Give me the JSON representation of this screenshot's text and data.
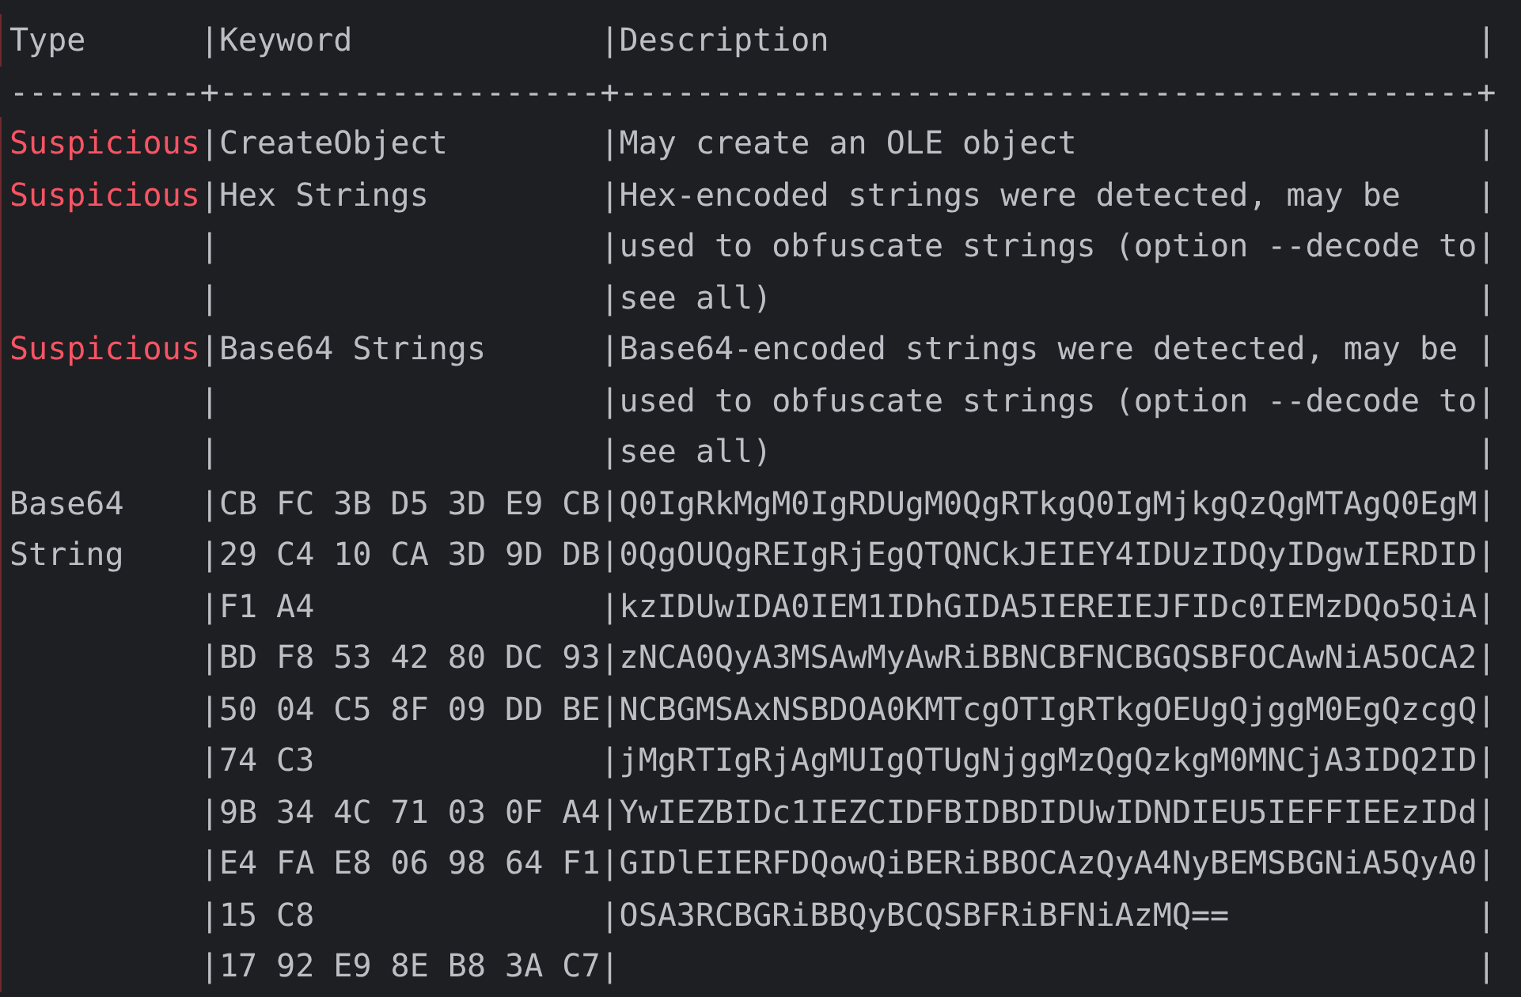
{
  "table": {
    "separator": "|",
    "columns": [
      "Type",
      "Keyword",
      "Description"
    ],
    "rule": "----------+--------------------+---------------------------------------------+",
    "rows": [
      {
        "kind": "suspicious",
        "type": [
          "Suspicious"
        ],
        "keyword": [
          "CreateObject"
        ],
        "description": [
          "May create an OLE object"
        ]
      },
      {
        "kind": "suspicious",
        "type": [
          "Suspicious"
        ],
        "keyword": [
          "Hex Strings"
        ],
        "description": [
          "Hex-encoded strings were detected, may be",
          "used to obfuscate strings (option --decode to",
          "see all)"
        ]
      },
      {
        "kind": "suspicious",
        "type": [
          "Suspicious"
        ],
        "keyword": [
          "Base64 Strings"
        ],
        "description": [
          "Base64-encoded strings were detected, may be",
          "used to obfuscate strings (option --decode to",
          "see all)"
        ]
      },
      {
        "kind": "info",
        "type": [
          "Base64",
          "String"
        ],
        "keyword": [
          "CB FC 3B D5 3D E9 CB",
          "29 C4 10 CA 3D 9D DB",
          "F1 A4",
          "BD F8 53 42 80 DC 93",
          "50 04 C5 8F 09 DD BE",
          "74 C3",
          "9B 34 4C 71 03 0F A4",
          "E4 FA E8 06 98 64 F1",
          "15 C8",
          "17 92 E9 8E B8 3A C7"
        ],
        "description": [
          "Q0IgRkMgM0IgRDUgM0QgRTkgQ0IgMjkgQzQgMTAgQ0EgM",
          "0QgOUQgREIgRjEgQTQNCkJEIEY4IDUzIDQyIDgwIERDID",
          "kzIDUwIDA0IEM1IDhGIDA5IEREIEJFIDc0IEMzDQo5QiA",
          "zNCA0QyA3MSAwMyAwRiBBNCBFNCBGQSBFOCAwNiA5OCA2",
          "NCBGMSAxNSBDOA0KMTcgOTIgRTkgOEUgQjggM0EgQzcgQ",
          "jMgRTIgRjAgMUIgQTUgNjggMzQgQzkgM0MNCjA3IDQ2ID",
          "YwIEZBIDc1IEZCIDFBIDBDIDUwIDNDIEU5IEFFIEEzIDd",
          "GIDlEIERFDQowQiBERiBBOCAzQyA4NyBEMSBGNiA5QyA0",
          "OSA3RCBGRiBBQyBCQSBFRiBFNiAzMQ=="
        ]
      }
    ]
  }
}
